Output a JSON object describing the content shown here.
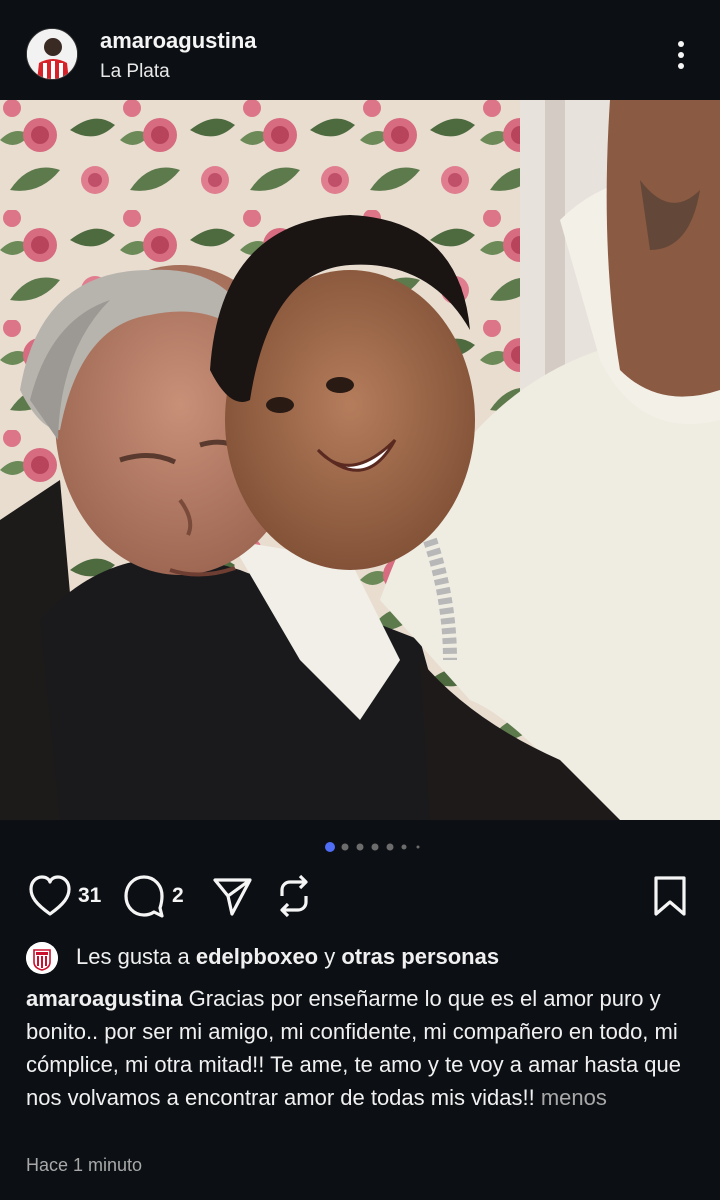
{
  "post": {
    "username": "amaroagustina",
    "location": "La Plata"
  },
  "carousel": {
    "count": 7,
    "active_index": 0
  },
  "actions": {
    "like_count": "31",
    "comment_count": "2"
  },
  "likes": {
    "prefix": "Les gusta a ",
    "account": "edelpboxeo",
    "connector": " y ",
    "others": "otras personas"
  },
  "caption": {
    "username": "amaroagustina",
    "text": "Gracias por enseñarme lo que es el amor puro y bonito.. por ser mi amigo, mi confidente, mi compañero en todo, mi cómplice, mi otra mitad!! Te ame, te amo y te voy a amar hasta que nos volvamos a encontrar amor de todas mis vidas!!",
    "less_label": "menos"
  },
  "timestamp": "Hace 1 minuto",
  "colors": {
    "background": "#0c1014",
    "text": "#f5f5f5",
    "muted": "#a8a8a8",
    "carousel_active": "#4f6df5"
  },
  "icons": [
    "more-vertical-icon",
    "heart-icon",
    "comment-icon",
    "share-icon",
    "repost-icon",
    "bookmark-icon",
    "club-badge-icon"
  ]
}
